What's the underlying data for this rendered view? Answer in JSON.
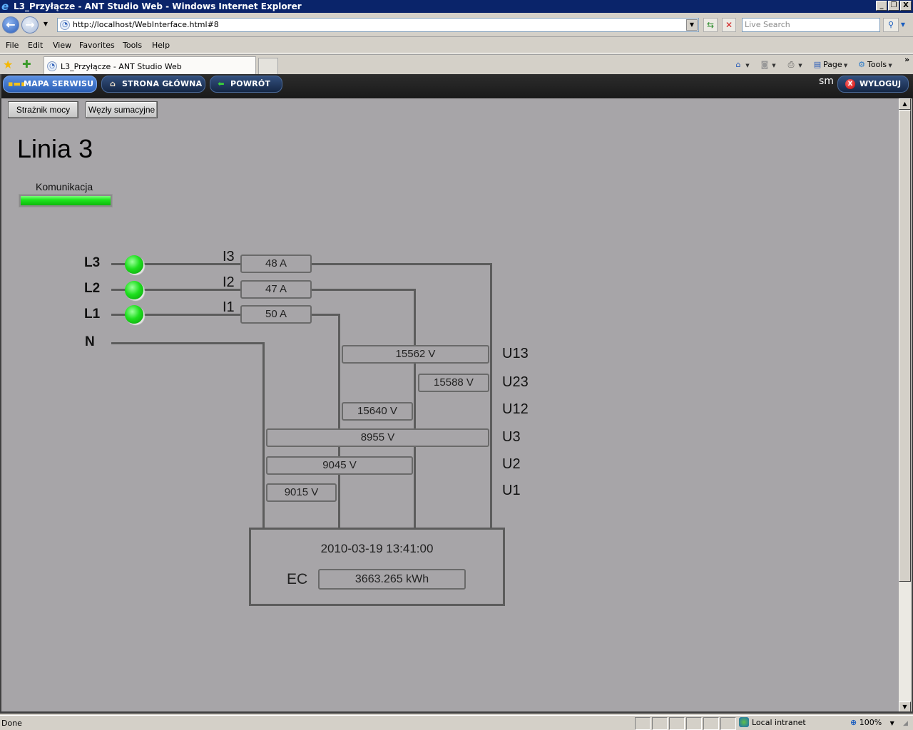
{
  "window": {
    "title": "L3_Przyłącze - ANT Studio Web - Windows Internet Explorer",
    "minimize": "_",
    "restore": "❐",
    "close": "X"
  },
  "browser": {
    "url": "http://localhost/WebInterface.html#8",
    "search_placeholder": "Live Search",
    "menu": [
      "File",
      "Edit",
      "View",
      "Favorites",
      "Tools",
      "Help"
    ],
    "tab_title": "L3_Przyłącze - ANT Studio Web",
    "commands": {
      "page": "Page",
      "tools": "Tools"
    },
    "status": "Done",
    "zone": "Local intranet",
    "zoom": "100%"
  },
  "app_nav": {
    "buttons": [
      {
        "label": "MAPA SERWISU",
        "icon": "sitemap-icon",
        "active": true
      },
      {
        "label": "STRONA GŁÓWNA",
        "icon": "home-icon",
        "active": false
      },
      {
        "label": "POWRÓT",
        "icon": "back-arrow-icon",
        "active": false
      }
    ],
    "user": "sm",
    "logout_label": "WYLOGUJ"
  },
  "page": {
    "sub_buttons": [
      "Strażnik mocy",
      "Węzły sumacyjne"
    ],
    "title": "Linia 3",
    "communication": {
      "label": "Komunikacja",
      "status": "ok",
      "color": "#1ee61e"
    }
  },
  "diagram": {
    "phases": [
      {
        "name": "L3",
        "current_label": "I3",
        "current": "48 A",
        "led": "on"
      },
      {
        "name": "L2",
        "current_label": "I2",
        "current": "47 A",
        "led": "on"
      },
      {
        "name": "L1",
        "current_label": "I1",
        "current": "50 A",
        "led": "on"
      },
      {
        "name": "N"
      }
    ],
    "voltages": [
      {
        "label": "U13",
        "value": "15562 V"
      },
      {
        "label": "U23",
        "value": "15588 V"
      },
      {
        "label": "U12",
        "value": "15640 V"
      },
      {
        "label": "U3",
        "value": "8955 V"
      },
      {
        "label": "U2",
        "value": "9045 V"
      },
      {
        "label": "U1",
        "value": "9015 V"
      }
    ],
    "meter": {
      "timestamp": "2010-03-19 13:41:00",
      "energy_label": "EC",
      "energy_value": "3663.265 kWh"
    }
  }
}
